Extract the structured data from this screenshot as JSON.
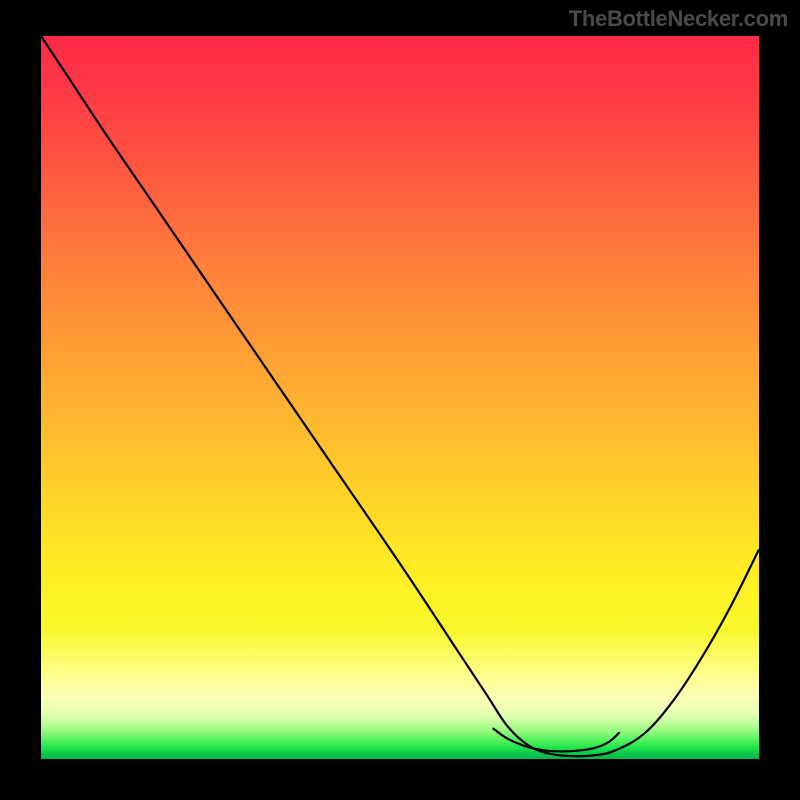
{
  "brand": "TheBottleNecker.com",
  "colors": {
    "top": "#ff2a47",
    "bottom": "#06b84d",
    "marker": "#da6a66",
    "curve": "#000000",
    "page_bg": "#000000"
  },
  "chart_data": {
    "type": "line",
    "title": "",
    "xlabel": "",
    "ylabel": "",
    "xlim": [
      0,
      100
    ],
    "ylim": [
      0,
      100
    ],
    "series": [
      {
        "name": "bottleneck-curve",
        "x": [
          0,
          4,
          10,
          20,
          30,
          40,
          50,
          58,
          62,
          65,
          68,
          71,
          74,
          77,
          80,
          84,
          88,
          92,
          96,
          100
        ],
        "y": [
          100,
          94,
          85,
          70.5,
          56,
          41.5,
          27,
          15,
          9,
          4.5,
          1.8,
          0.7,
          0.4,
          0.5,
          1.2,
          3.5,
          8,
          14,
          21,
          29
        ]
      }
    ],
    "marker": {
      "name": "optimum-range",
      "x": [
        63,
        65,
        68,
        71,
        74,
        77,
        79,
        80.5
      ],
      "y": [
        4.2,
        2.8,
        1.6,
        1.1,
        1.1,
        1.5,
        2.3,
        3.6
      ]
    }
  }
}
